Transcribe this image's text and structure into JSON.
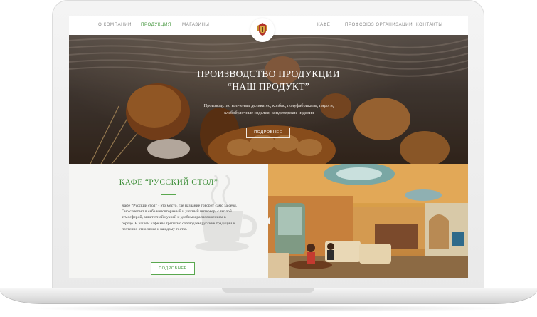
{
  "nav": {
    "items": [
      "О компании",
      "Продукция",
      "Магазины",
      "Кафе",
      "Профсоюз организации",
      "Контакты"
    ],
    "active_index": 1
  },
  "hero": {
    "title_line1": "ПРОИЗВОДСТВО ПРОДУКЦИИ",
    "title_line2": "“НАШ ПРОДУКТ”",
    "subtitle": "Производство копченых деликатес, колбас, полуфабрикаты, пироги, хлебобулочные изделия, кондитерские изделия",
    "button_label": "ПОДРОБНЕЕ"
  },
  "cafe": {
    "title": "КАФЕ  “РУССКИЙ СТОЛ”",
    "description": "Кафе “Русский стол” - это место, где название говорит само за себя. Оно сочетает в себе неповторимый и уютный интерьер, с теплой атмосферой, аппетитной кухней и удобным расположением в городе. В нашем кафе мы трепетно соблюдаем русские традиции и почтенно относимся к каждому гостю.",
    "button_label": "ПОДРОБНЕЕ"
  },
  "colors": {
    "accent": "#4a9a43",
    "hero_dark": "#3a2b20",
    "cafe_bg": "#f5f5f3"
  }
}
